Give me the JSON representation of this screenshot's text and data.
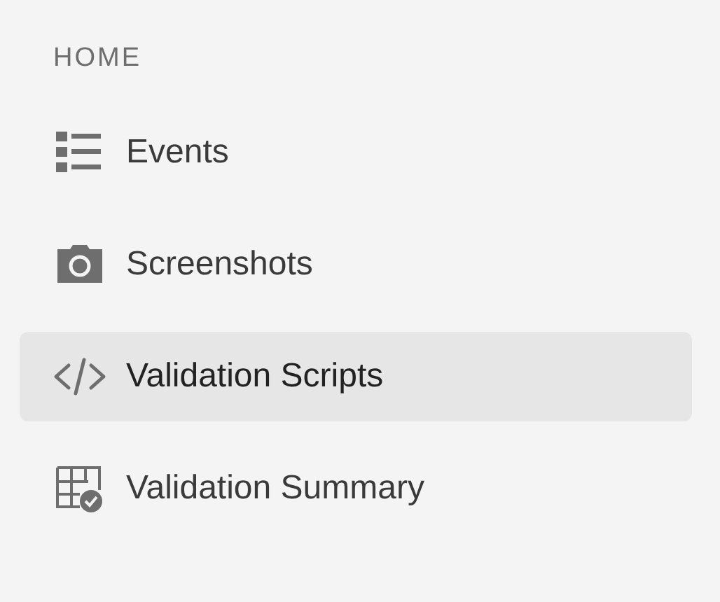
{
  "section": {
    "title": "HOME"
  },
  "items": [
    {
      "kind": "list",
      "label": "Events",
      "selected": false
    },
    {
      "kind": "camera",
      "label": "Screenshots",
      "selected": false
    },
    {
      "kind": "code",
      "label": "Validation Scripts",
      "selected": true
    },
    {
      "kind": "table-check",
      "label": "Validation Summary",
      "selected": false
    }
  ]
}
